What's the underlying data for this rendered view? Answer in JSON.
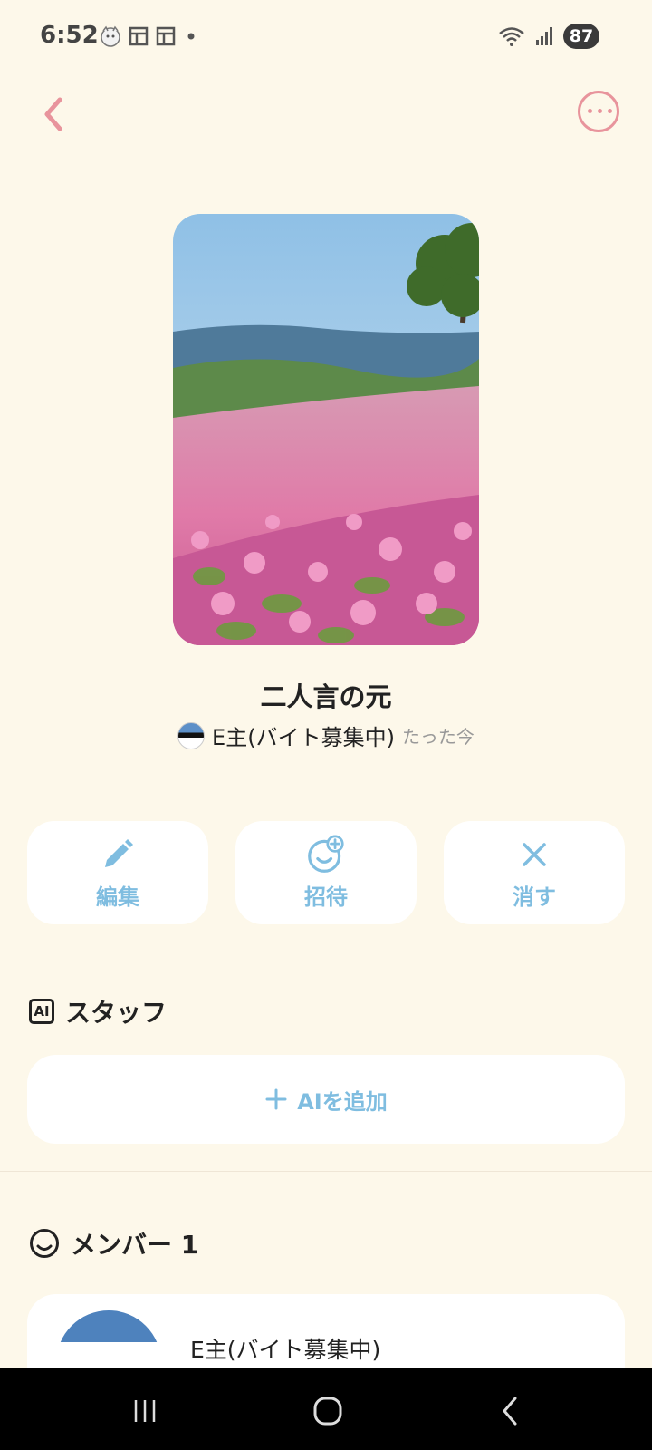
{
  "status_bar": {
    "time": "6:52",
    "battery": "87",
    "left_icons": [
      "cat-avatar-icon",
      "notification-panel-icon",
      "notification-panel-icon",
      "dot-icon"
    ],
    "right_icons": [
      "wifi-icon",
      "signal-icon"
    ]
  },
  "header": {
    "back_icon": "chevron-left-icon",
    "more_icon": "more-horizontal-icon"
  },
  "room": {
    "title": "二人言の元",
    "owner_name": "E主(バイト募集中)",
    "timestamp": "たった今"
  },
  "actions": [
    {
      "label": "編集",
      "icon": "pencil-icon"
    },
    {
      "label": "招待",
      "icon": "invite-face-plus-icon"
    },
    {
      "label": "消す",
      "icon": "close-icon"
    }
  ],
  "staff_section": {
    "title": "スタッフ",
    "badge_text": "AI",
    "add_button_label": "AIを追加"
  },
  "members_section": {
    "title": "メンバー 1",
    "members": [
      {
        "name": "E主(バイト募集中)"
      }
    ]
  },
  "colors": {
    "background": "#fdf8ea",
    "accent_pink": "#e8949c",
    "accent_blue": "#7fbde0",
    "card": "#ffffff"
  }
}
